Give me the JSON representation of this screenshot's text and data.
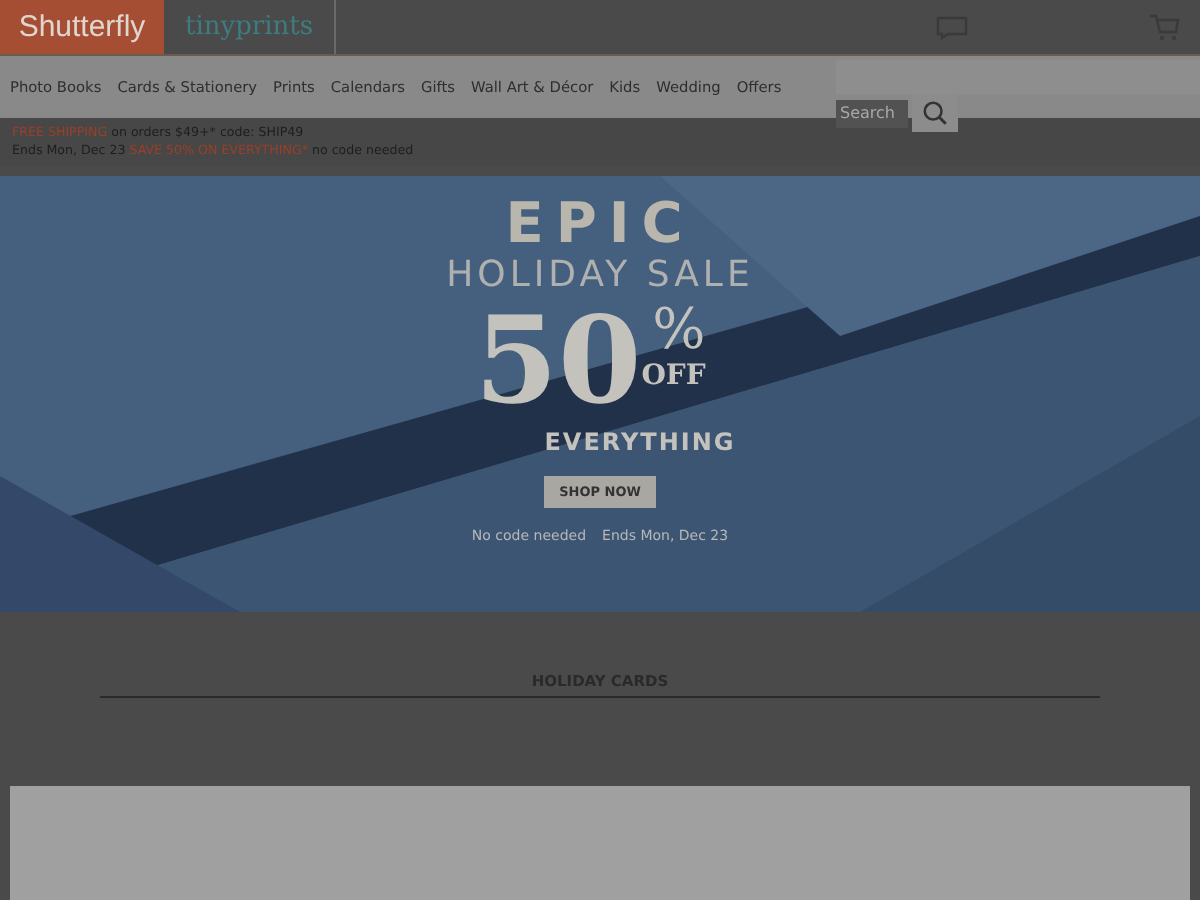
{
  "header": {
    "brands": [
      "Shutterfly",
      "tinyprints"
    ]
  },
  "nav": {
    "items": [
      "Photo Books",
      "Cards & Stationery",
      "Prints",
      "Calendars",
      "Gifts",
      "Wall Art & Décor",
      "Kids",
      "Wedding",
      "Offers"
    ]
  },
  "search": {
    "placeholder": "Search"
  },
  "promo": {
    "lines": [
      [
        {
          "text": "FREE SHIPPING",
          "highlight": true
        },
        {
          "text": " on orders $49+* code: SHIP49",
          "highlight": false
        }
      ],
      [
        {
          "text": "Ends Mon, Dec 23 ",
          "highlight": false
        },
        {
          "text": "SAVE 50% ON EVERYTHING*",
          "highlight": true
        },
        {
          "text": " no code needed",
          "highlight": false
        }
      ]
    ]
  },
  "hero": {
    "title": "EPIC",
    "subtitle": "HOLIDAY SALE",
    "amount": "50",
    "percent": "%",
    "off": "OFF",
    "scope": "EVERYTHING",
    "button": "SHOP NOW",
    "notes": [
      "No code needed",
      "Ends Mon, Dec 23"
    ]
  },
  "section": {
    "heading": "HOLIDAY CARDS"
  }
}
